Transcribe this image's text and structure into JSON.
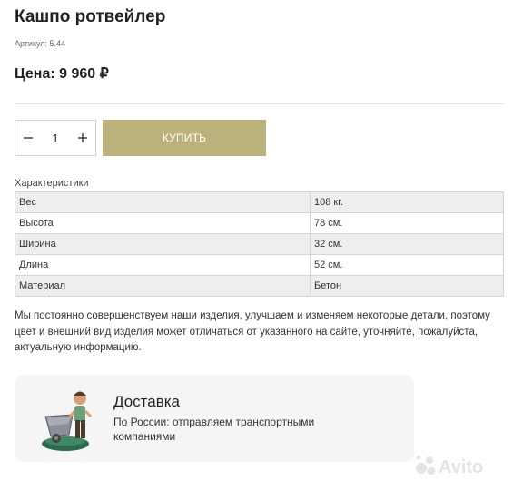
{
  "product": {
    "title": "Кашпо ротвейлер",
    "sku": "Артикул: 5.44",
    "price": "Цена: 9 960 ₽"
  },
  "cart": {
    "quantity": "1",
    "minus_icon": "minus-icon",
    "plus_icon": "plus-icon",
    "buy_label": "КУПИТЬ",
    "buy_color": "#bcb17b"
  },
  "specs": {
    "title": "Характеристики",
    "rows": [
      {
        "key": "Вес",
        "value": "108 кг."
      },
      {
        "key": "Высота",
        "value": "78 см."
      },
      {
        "key": "Ширина",
        "value": "32 см."
      },
      {
        "key": "Длина",
        "value": "52 см."
      },
      {
        "key": "Материал",
        "value": "Бетон"
      }
    ]
  },
  "note": "Мы постоянно совершенствуем наши изделия, улучшаем и изменяем некоторые детали, поэтому цвет и внешний вид изделия может отличаться от указанного на сайте, уточняйте, пожалуйста, актуальную информацию.",
  "delivery": {
    "title": "Доставка",
    "text": "По России: отправляем транспортными компаниями",
    "image_icon": "wheelbarrow-figure-icon"
  },
  "watermark": {
    "brand": "Avito"
  }
}
